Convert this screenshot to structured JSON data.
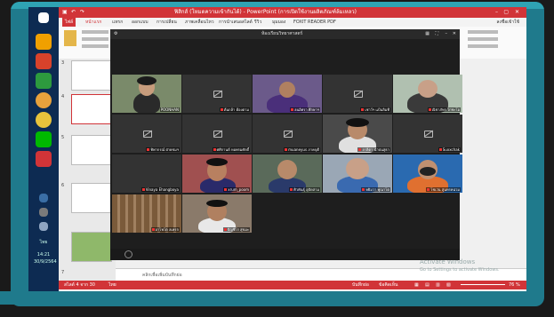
{
  "powerpoint": {
    "window_title": "ฟิสิกส์ (โหมดความเข้ากันได้) - PowerPoint (การเปิดใช้งานผลิตภัณฑ์ล้มเหลว)",
    "tabs": [
      "ไฟล์",
      "หน้าแรก",
      "แทรก",
      "ออกแบบ",
      "การเปลี่ยน",
      "ภาพเคลื่อนไหว",
      "การนำเสนอสไลด์",
      "รีวิว",
      "มุมมอง",
      "FOXIT READER PDF"
    ],
    "notes_placeholder": "คลิกเพื่อเพิ่มบันทึกย่อ",
    "status_left": "สไลด์ 4 จาก 30",
    "status_lang": "ไทย",
    "status_notes": "บันทึกย่อ",
    "status_comments": "ข้อคิดเห็น",
    "zoom": "76 %",
    "signin": "ลงชื่อเข้าใช้",
    "slide_numbers": [
      "3",
      "4",
      "5",
      "6",
      "7"
    ]
  },
  "zoom_meeting": {
    "title": "ห้องเรียนวิทยาศาสตร์",
    "participants": [
      {
        "name": "POONHAN",
        "video": true
      },
      {
        "name": "ต้นกล้า ต้องตาม",
        "video": false
      },
      {
        "name": "ฮนอิศรา ศึกษาฯ",
        "video": true
      },
      {
        "name": "เชาว์ฯ แป้นลิมที",
        "video": false
      },
      {
        "name": "ณิชาภัทร ไก่ชะโอ",
        "video": true
      },
      {
        "name": "ทิพากรณ์ ฝ่ายชมฯ",
        "video": false
      },
      {
        "name": "ศศิกานต์ หอพรมศักดิ์",
        "video": false
      },
      {
        "name": "muaneyus ภาคบุดี",
        "video": false
      },
      {
        "name": "ลาลิตา นำปนสุธา",
        "video": true
      },
      {
        "name": "Suxxchak",
        "video": false
      },
      {
        "name": "Vinaya Ehangboya",
        "video": false
      },
      {
        "name": "xrum_poom",
        "video": true
      },
      {
        "name": "ศิวพันธุ์ อุปัดสาม",
        "video": true
      },
      {
        "name": "หยิมวา พุณาโต",
        "video": true
      },
      {
        "name": "โชเว่น สุนทรหน่วม",
        "video": true
      },
      {
        "name": "อาโพโต ลเพรก",
        "video": true
      },
      {
        "name": "บิญชิโร สุขมะ",
        "video": true
      }
    ]
  },
  "watermark": {
    "line1": "Activate Windows",
    "line2": "Go to Settings to activate Windows."
  },
  "taskbar": {
    "time": "14:21",
    "lang": "ไทย",
    "date": "30/9/2564"
  },
  "colors": {
    "ppt_red": "#d13438",
    "frame_teal": "#1f7a8c",
    "zoom_bg": "#1e1e1e"
  }
}
